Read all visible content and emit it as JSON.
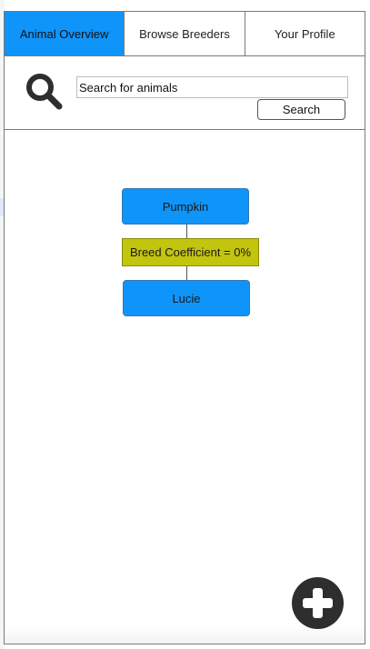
{
  "tabs": [
    {
      "label": "Animal Overview",
      "active": true
    },
    {
      "label": "Browse Breeders",
      "active": false
    },
    {
      "label": "Your Profile",
      "active": false
    }
  ],
  "search": {
    "icon": "search-icon",
    "value": "Search for animals",
    "button_label": "Search"
  },
  "tree": {
    "parent": "Pumpkin",
    "coefficient": "Breed Coefficient = 0%",
    "child": "Lucie"
  },
  "fab": {
    "icon": "plus-icon"
  },
  "colors": {
    "accent": "#0f94f9",
    "coefficient": "#c3c40e",
    "fab": "#2e2e2e"
  }
}
